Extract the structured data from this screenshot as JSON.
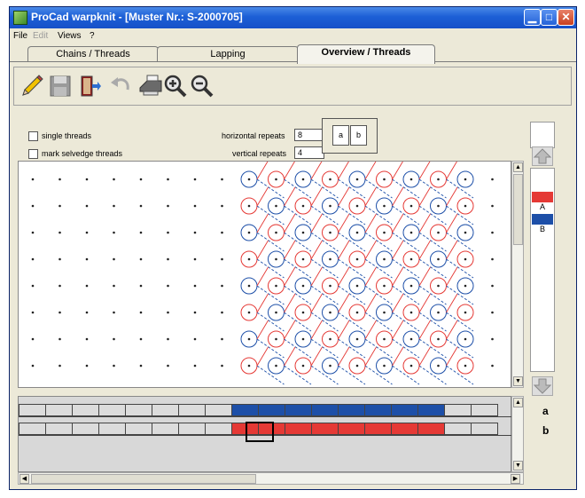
{
  "window": {
    "title": "ProCad warpknit - [Muster Nr.: S-2000705]"
  },
  "menu": {
    "file": "File",
    "edit": "Edit",
    "views": "Views",
    "help": "?"
  },
  "tabs": [
    {
      "label": "Chains / Threads",
      "active": false
    },
    {
      "label": "Lapping",
      "active": false
    },
    {
      "label": "Overview / Threads",
      "active": true
    }
  ],
  "toolbar": {
    "tools": [
      "pencil-icon",
      "save-icon",
      "exit-icon",
      "undo-icon",
      "print-icon",
      "zoom-in-icon",
      "zoom-out-icon"
    ]
  },
  "options": {
    "single_threads": "single threads",
    "mark_selvedge_threads": "mark selvedge threads",
    "horizontal_repeats_label": "horizontal repeats",
    "horizontal_repeats_value": "8",
    "vertical_repeats_label": "vertical repeats",
    "vertical_repeats_value": "4",
    "bar_a": "a",
    "bar_b": "b"
  },
  "legend": {
    "a": "A",
    "b": "B"
  },
  "bars": {
    "a": {
      "label": "a",
      "color": "#1d4fa8"
    },
    "b": {
      "label": "b",
      "color": "#e53935"
    }
  },
  "colors": {
    "thread_a": "#1d4fa8",
    "thread_b": "#e53935",
    "window_bg": "#ece9d8"
  }
}
